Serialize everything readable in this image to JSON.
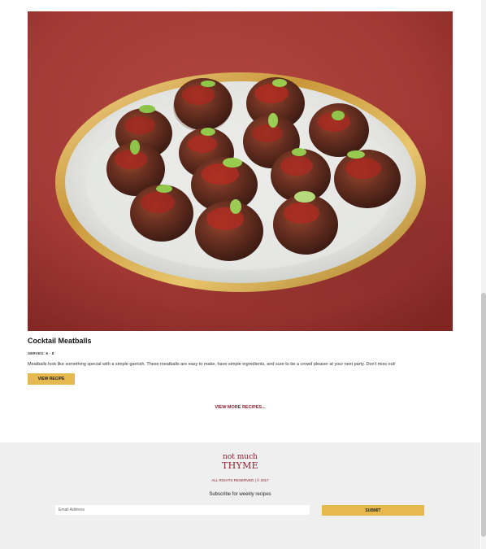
{
  "recipe": {
    "image_alt": "Cocktail meatballs on a gold-rimmed plate",
    "title": "Cocktail Meatballs",
    "serves": "SERVES: 6 - 8",
    "description": "Meatballs look like something special with a simple garnish. These meatballs are easy to make, have simple ingredients, and sure to be a crowd pleaser at your next party. Don't miss out!",
    "view_button_label": "VIEW RECIPE"
  },
  "view_more_label": "VIEW MORE RECIPES...",
  "footer": {
    "logo_top": "not much",
    "logo_bottom": "THYME",
    "copyright": "ALL RIGHTS RESERVED | © 2017",
    "subscribe_label": "Subscribe for weekly recipes",
    "email_placeholder": "Email Address",
    "submit_label": "SUBMIT"
  },
  "colors": {
    "accent_gold": "#e6b94f",
    "brand_red": "#8c1d2e",
    "footer_bg": "#efefef"
  }
}
